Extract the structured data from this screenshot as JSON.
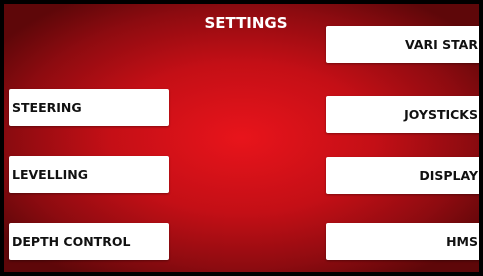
{
  "header": {
    "title": "SETTINGS"
  },
  "left_buttons": [
    {
      "label": "STEERING"
    },
    {
      "label": "LEVELLING"
    },
    {
      "label": "DEPTH CONTROL"
    }
  ],
  "right_buttons": [
    {
      "label": "VARI STAR"
    },
    {
      "label": "JOYSTICKS"
    },
    {
      "label": "DISPLAY"
    },
    {
      "label": "HMS"
    }
  ],
  "colors": {
    "background_center": "#e8141b",
    "background_edge": "#5e0709",
    "frame": "#000000",
    "button_bg": "#ffffff",
    "button_text": "#111111",
    "title_text": "#ffffff"
  }
}
